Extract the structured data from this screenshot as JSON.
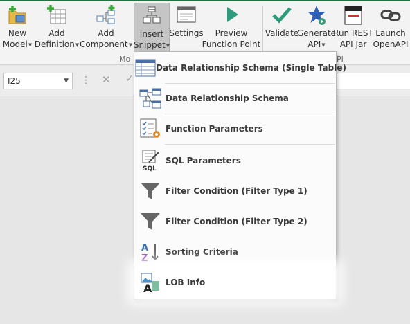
{
  "ribbon": {
    "buttons": [
      {
        "line1": "New",
        "line2": "Model"
      },
      {
        "line1": "Add",
        "line2": "Definition"
      },
      {
        "line1": "Add",
        "line2": "Component"
      },
      {
        "line1": "Insert",
        "line2": "Snippet"
      },
      {
        "line1": "Settings",
        "line2": ""
      },
      {
        "line1": "Preview",
        "line2": "Function Point"
      },
      {
        "line1": "Validate",
        "line2": ""
      },
      {
        "line1": "Generate",
        "line2": "API"
      },
      {
        "line1": "Run REST",
        "line2": "API Jar"
      },
      {
        "line1": "Launch",
        "line2": "OpenAPI"
      }
    ],
    "group_labels": [
      "Mo",
      "PI"
    ]
  },
  "formula_bar": {
    "cell_ref": "I25"
  },
  "snippet_menu": {
    "items": [
      {
        "label": "Data Relationship Schema (Single Table)",
        "icon": "single-table-schema-icon"
      },
      {
        "label": "Data Relationship Schema",
        "icon": "relationship-schema-icon"
      },
      {
        "label": "Function Parameters",
        "icon": "function-parameters-icon"
      },
      {
        "label": "SQL Parameters",
        "icon": "sql-parameters-icon"
      },
      {
        "label": "Filter Condition (Filter Type 1)",
        "icon": "filter-icon"
      },
      {
        "label": "Filter Condition (Filter Type 2)",
        "icon": "filter-icon"
      },
      {
        "label": "Sorting Criteria",
        "icon": "sort-az-icon"
      },
      {
        "label": "LOB Info",
        "icon": "lob-info-icon"
      }
    ],
    "highlighted_item": "LOB Info"
  },
  "colors": {
    "accent": "#217346",
    "menu_background": "#fbfbfb",
    "ribbon_background": "#f3f3f3"
  }
}
